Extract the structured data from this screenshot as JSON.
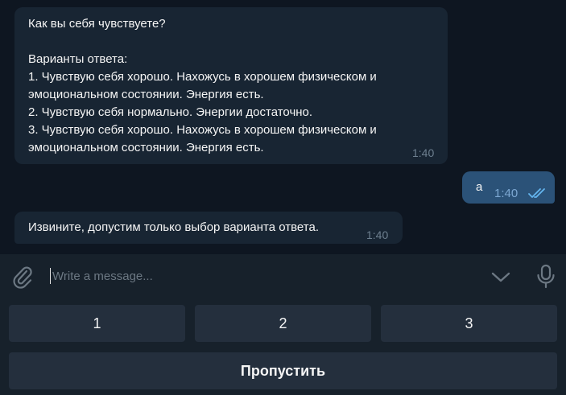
{
  "messages": [
    {
      "direction": "incoming",
      "text": "Как вы себя чувствуете?\n\nВарианты ответа:\n1. Чувствую себя хорошо. Нахожусь в хорошем физическом и эмоциональном состоянии. Энергия есть.\n2. Чувствую себя нормально. Энергии достаточно.\n3. Чувствую себя хорошо. Нахожусь в хорошем физическом и эмоциональном состоянии. Энергия есть.",
      "time": "1:40"
    },
    {
      "direction": "outgoing",
      "text": "a",
      "time": "1:40",
      "status": "read"
    },
    {
      "direction": "incoming",
      "text": "Извините, допустим только выбор варианта ответа.",
      "time": "1:40"
    }
  ],
  "composer": {
    "placeholder": "Write a message..."
  },
  "keyboard": {
    "row1": [
      "1",
      "2",
      "3"
    ],
    "skip_label": "Пропустить"
  },
  "colors": {
    "chat_background": "#0e1621",
    "incoming_bubble": "#182533",
    "outgoing_bubble": "#2b5278",
    "panel": "#17212b",
    "keyboard_button": "#242f3d",
    "read_check": "#64b5ef"
  },
  "icons": {
    "attach": "paperclip-icon",
    "scroll": "chevron-down-icon",
    "voice": "microphone-icon",
    "status": "double-check-icon"
  }
}
